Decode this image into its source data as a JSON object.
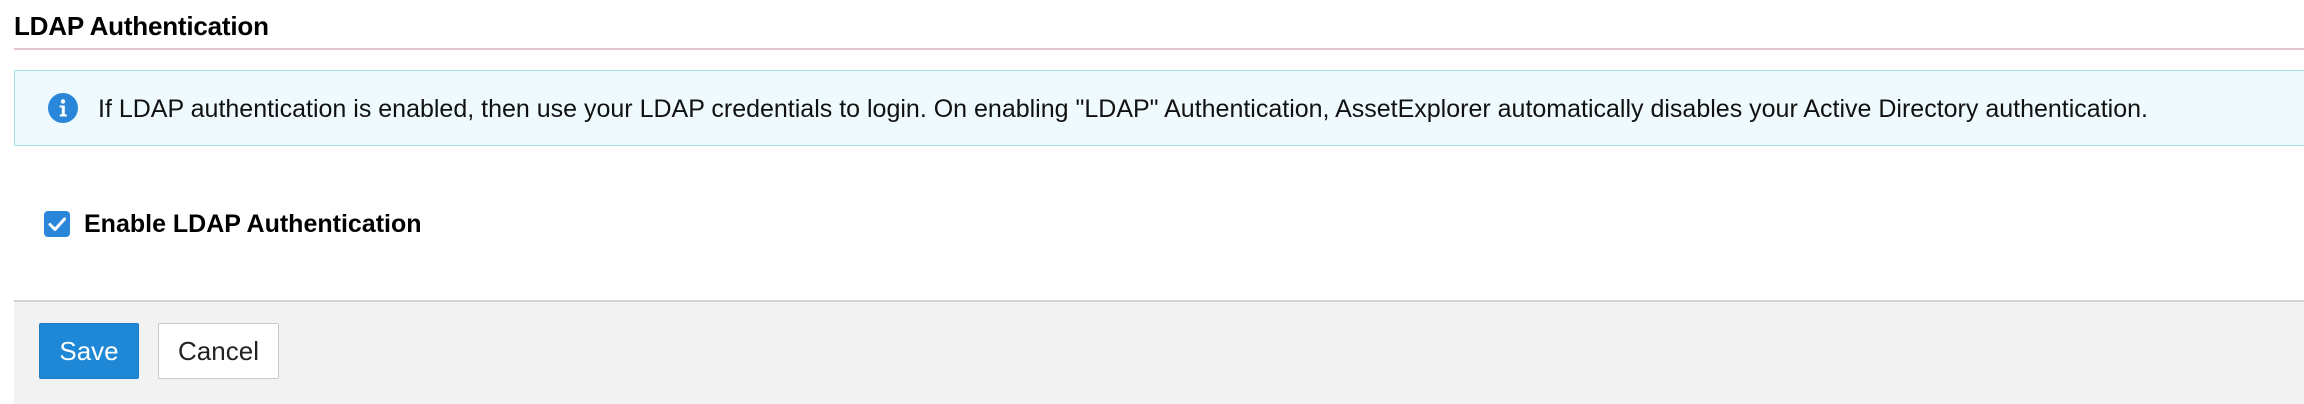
{
  "section": {
    "title": "LDAP Authentication"
  },
  "info": {
    "icon": "info-icon",
    "message": "If LDAP authentication is enabled, then use your LDAP credentials to login. On enabling \"LDAP\" Authentication, AssetExplorer automatically disables your Active Directory authentication."
  },
  "form": {
    "enable_ldap": {
      "label": "Enable LDAP Authentication",
      "checked": true
    }
  },
  "actions": {
    "save_label": "Save",
    "cancel_label": "Cancel"
  },
  "colors": {
    "accent": "#2a86d8",
    "save_button": "#1e88d6",
    "info_background": "#eefafd",
    "info_border": "#a6e1ec",
    "footer_background": "#f2f2f2",
    "title_rule": "#e6c6ca"
  }
}
